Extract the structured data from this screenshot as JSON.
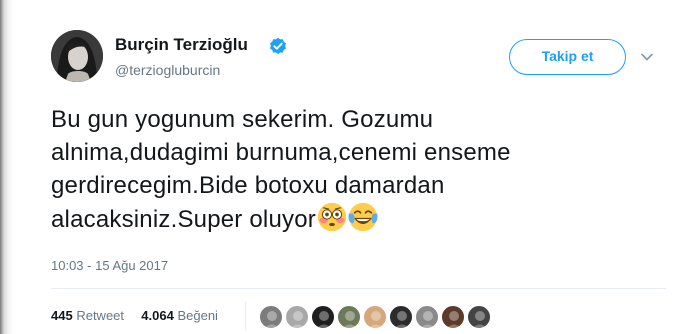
{
  "tweet": {
    "display_name": "Burçin Terzioğlu",
    "handle": "@terziogluburcin",
    "follow_label": "Takip et",
    "text_lines": [
      "Bu gun yogunum sekerim. Gozumu",
      "alnima,dudagimi burnuma,cenemi enseme",
      "gerdirecegim.Bide botoxu damardan",
      "alacaksiniz.Super oluyor"
    ],
    "emojis": [
      "flushed-face-icon",
      "face-with-tears-of-joy-icon"
    ],
    "timestamp": "10:03 - 15 Ağu 2017",
    "retweet_count": "445",
    "retweet_label": "Retweet",
    "like_count": "4.064",
    "like_label": "Beğeni",
    "likers": [
      {
        "color": "#7c7c7c"
      },
      {
        "color": "#a8a8a8"
      },
      {
        "color": "#1f1f1f"
      },
      {
        "color": "#6d7a5a"
      },
      {
        "color": "#d6a77a"
      },
      {
        "color": "#2c2c2c"
      },
      {
        "color": "#8a8a8a"
      },
      {
        "color": "#5b3a2a"
      },
      {
        "color": "#444444"
      }
    ]
  },
  "colors": {
    "accent": "#1da1f2",
    "secondary_text": "#657786",
    "primary_text": "#14171a"
  }
}
